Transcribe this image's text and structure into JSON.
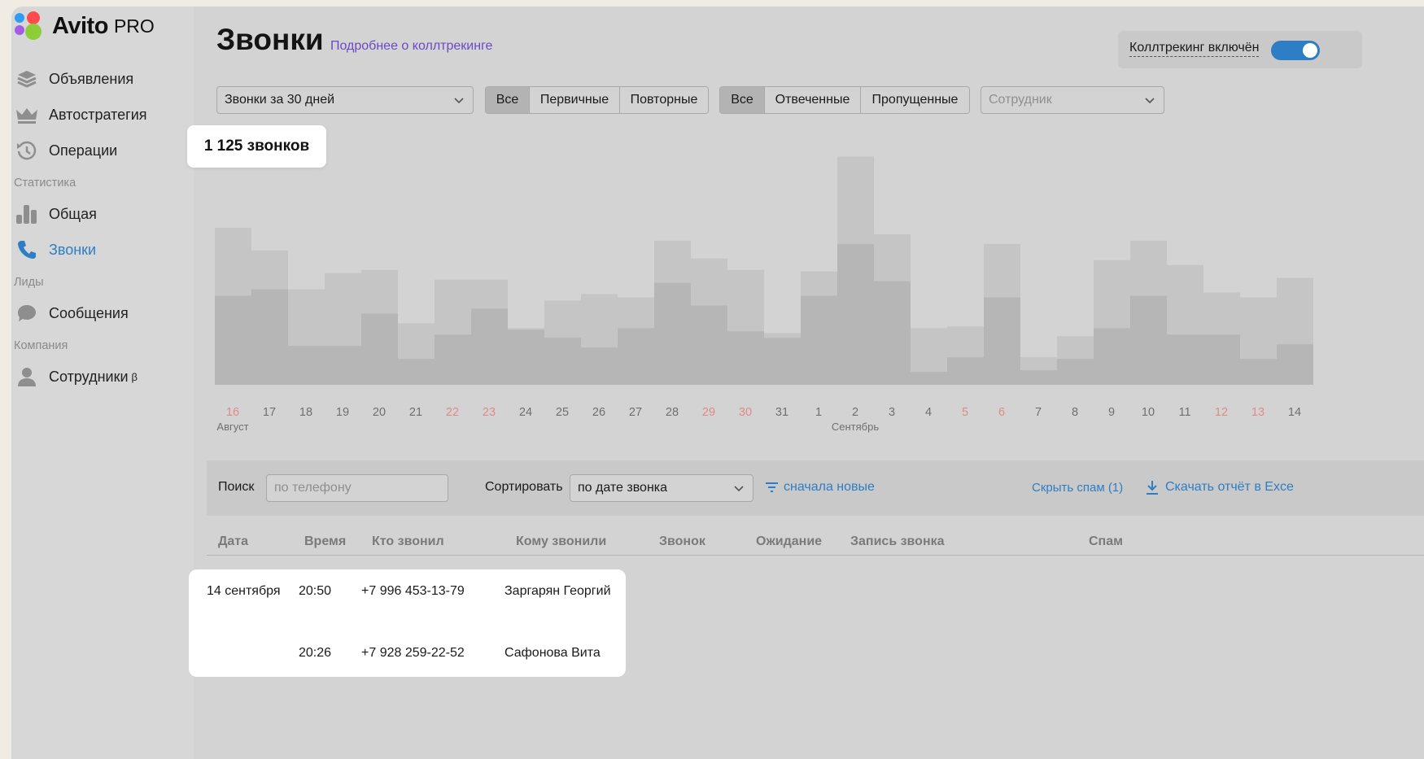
{
  "brand": {
    "name": "Avito",
    "suffix": "PRO"
  },
  "sidebar": {
    "items": [
      {
        "label": "Объявления",
        "icon": "stack-icon"
      },
      {
        "label": "Автостратегия",
        "icon": "crown-icon"
      },
      {
        "label": "Операции",
        "icon": "history-icon"
      }
    ],
    "section_stats": "Статистика",
    "stats_items": [
      {
        "label": "Общая",
        "icon": "bar-chart-icon"
      },
      {
        "label": "Звонки",
        "icon": "phone-icon",
        "active": true
      }
    ],
    "section_leads": "Лиды",
    "leads_items": [
      {
        "label": "Сообщения",
        "icon": "chat-bubble-icon"
      }
    ],
    "section_company": "Компания",
    "company_items": [
      {
        "label": "Сотрудники",
        "sup": "β",
        "icon": "person-icon"
      }
    ]
  },
  "header": {
    "title": "Звонки",
    "link": "Подробнее о коллтрекинге",
    "toggle_label": "Коллтрекинг включён",
    "toggle_on": true
  },
  "filters": {
    "period": "Звонки за 30 дней",
    "type_options": [
      "Все",
      "Первичные",
      "Повторные"
    ],
    "type_selected": "Все",
    "status_options": [
      "Все",
      "Отвеченные",
      "Пропущенные"
    ],
    "status_selected": "Все",
    "employee_placeholder": "Сотрудник"
  },
  "summary": {
    "total": "1 125 звонков"
  },
  "chart_data": {
    "type": "bar",
    "stacked": true,
    "categories": [
      "16",
      "17",
      "18",
      "19",
      "20",
      "21",
      "22",
      "23",
      "24",
      "25",
      "26",
      "27",
      "28",
      "29",
      "30",
      "31",
      "1",
      "2",
      "3",
      "4",
      "5",
      "6",
      "7",
      "8",
      "9",
      "10",
      "11",
      "12",
      "13",
      "14"
    ],
    "month_labels": [
      {
        "at": "16",
        "label": "Август"
      },
      {
        "at": "2",
        "label": "Сентябрь"
      }
    ],
    "weekend_days": [
      "16",
      "22",
      "23",
      "29",
      "30",
      "5",
      "6",
      "12",
      "13"
    ],
    "series": [
      {
        "values": [
          55,
          59,
          24,
          24,
          44,
          16,
          31,
          47,
          34,
          29,
          23,
          35,
          63,
          49,
          33,
          29,
          55,
          87,
          64,
          8,
          17,
          54,
          9,
          16,
          35,
          55,
          31,
          31,
          16,
          25
        ]
      },
      {
        "values": [
          97,
          83,
          59,
          69,
          71,
          38,
          65,
          65,
          35,
          52,
          56,
          54,
          89,
          78,
          71,
          32,
          70,
          141,
          93,
          35,
          36,
          87,
          17,
          30,
          77,
          89,
          74,
          57,
          54,
          66
        ]
      }
    ],
    "series_colors": [
      "#b6b6b6",
      "#c5c5c5"
    ],
    "weekend_color": "#e08a8a"
  },
  "toolbar": {
    "search_label": "Поиск",
    "search_placeholder": "по телефону",
    "sort_label": "Сортировать",
    "sort_value": "по дате звонка",
    "order": "сначала новые",
    "hide_spam": "Скрыть спам (1)",
    "download": "Скачать отчёт в Exce"
  },
  "table": {
    "columns": [
      "Дата",
      "Время",
      "Кто звонил",
      "Кому звонили",
      "Звонок",
      "Ожидание",
      "Запись звонка",
      "Спам"
    ],
    "rows": [
      {
        "date": "14 сентября",
        "time": "20:50",
        "from": "+7 996 453-13-79",
        "to": "Заргарян Георгий"
      },
      {
        "date": "",
        "time": "20:26",
        "from": "+7 928 259-22-52",
        "to": "Сафонова Вита"
      }
    ]
  }
}
